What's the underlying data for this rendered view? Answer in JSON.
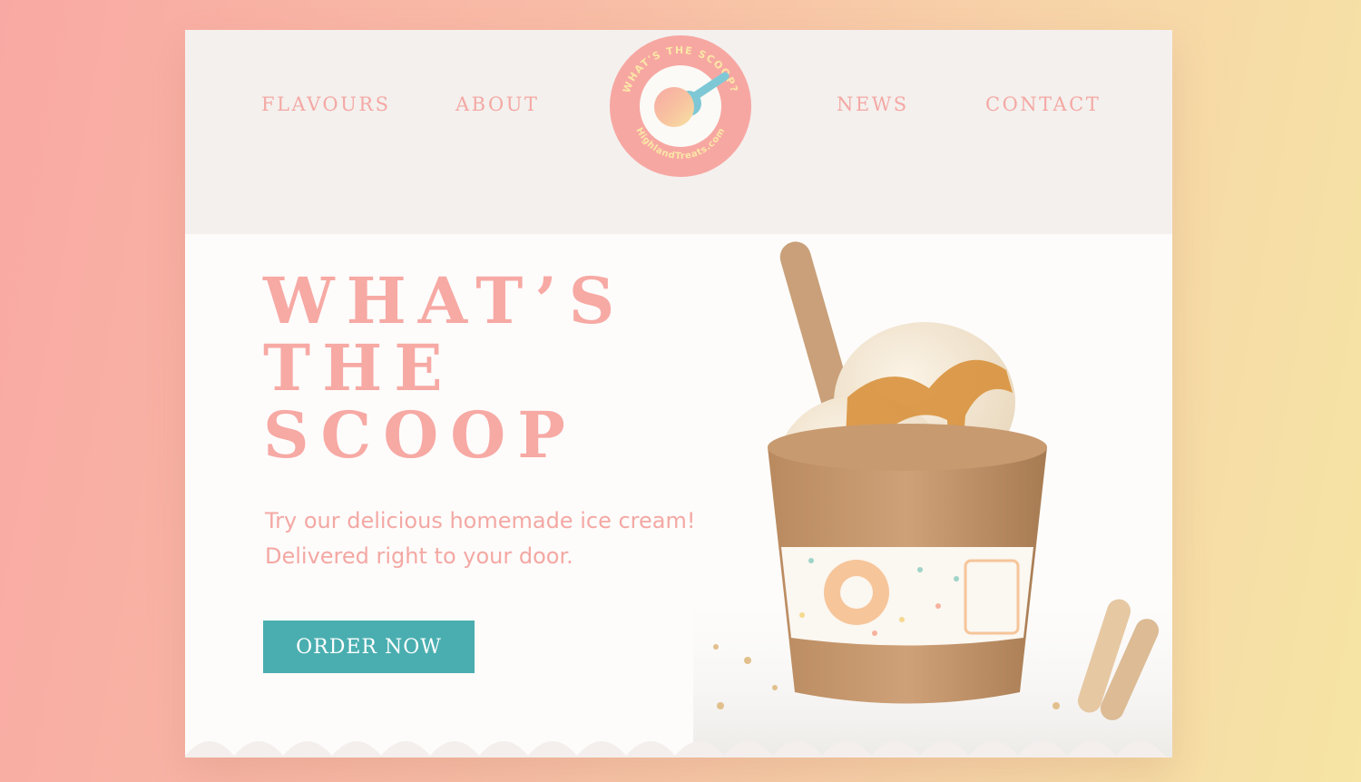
{
  "nav": {
    "left": [
      {
        "label": "FLAVOURS"
      },
      {
        "label": "ABOUT"
      }
    ],
    "right": [
      {
        "label": "NEWS"
      },
      {
        "label": "CONTACT"
      }
    ]
  },
  "logo": {
    "top_text": "WHAT'S THE SCOOP?",
    "bottom_text": "HighlandTreats.com"
  },
  "hero": {
    "title_lines": [
      "WHAT’S",
      "THE",
      "SCOOP"
    ],
    "tagline_lines": [
      "Try our delicious homemade ice cream!",
      "Delivered right to your door."
    ],
    "cta_label": "ORDER NOW"
  },
  "colors": {
    "background_left": "#f9a9a3",
    "background_right": "#f6e5a4",
    "header_bg": "#f4f0ee",
    "brand_pink": "#f4a8a3",
    "cta_teal": "#4aaeb0",
    "scoop_blue": "#7ec8d6"
  },
  "icons": {
    "logo": "ice-cream-scoop-icon",
    "product": "ice-cream-cup-image"
  }
}
